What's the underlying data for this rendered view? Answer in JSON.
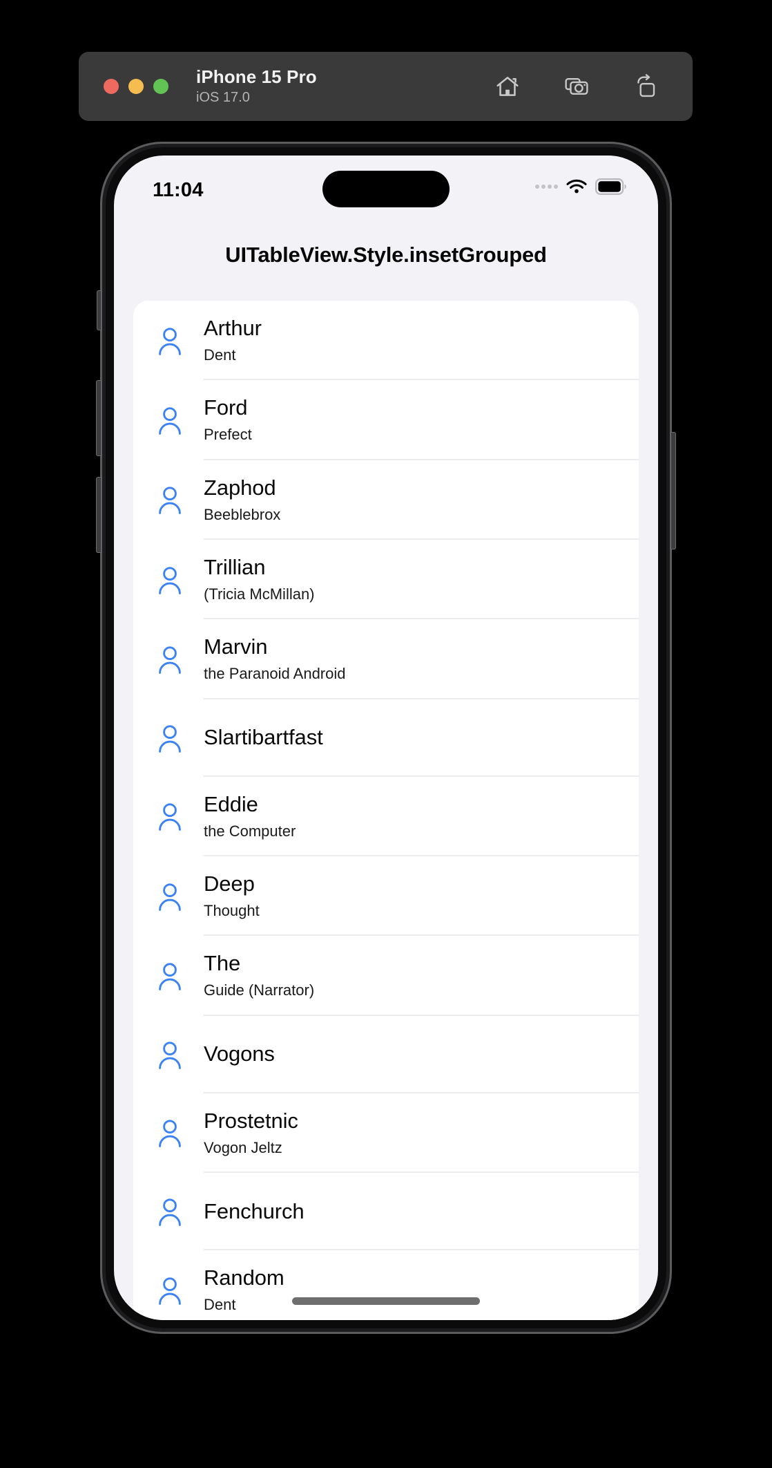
{
  "simulator": {
    "device_name": "iPhone 15 Pro",
    "os_version": "iOS 17.0",
    "window_controls": [
      {
        "name": "close",
        "color": "#ee6a5f"
      },
      {
        "name": "minimize",
        "color": "#f5bd4f"
      },
      {
        "name": "zoom",
        "color": "#61c454"
      }
    ],
    "toolbar": [
      {
        "icon": "home-icon",
        "label": "Home"
      },
      {
        "icon": "screenshot-camera-icon",
        "label": "Screenshot"
      },
      {
        "icon": "rotate-icon",
        "label": "Rotate"
      }
    ]
  },
  "status_bar": {
    "time": "11:04",
    "signal_icon": "signal-dots-icon",
    "wifi_icon": "wifi-icon",
    "battery_icon": "battery-icon"
  },
  "screen": {
    "page_title": "UITableView.Style.insetGrouped",
    "accent_color": "#3b82f6",
    "background_color": "#f2f2f7",
    "card_color": "#ffffff",
    "separator_color": "#ececee"
  },
  "table": {
    "style": "insetGrouped",
    "row_icon": "person-icon",
    "rows": [
      {
        "title": "Arthur",
        "subtitle": "Dent"
      },
      {
        "title": "Ford",
        "subtitle": "Prefect"
      },
      {
        "title": "Zaphod",
        "subtitle": "Beeblebrox"
      },
      {
        "title": "Trillian",
        "subtitle": "(Tricia McMillan)"
      },
      {
        "title": "Marvin",
        "subtitle": "the Paranoid Android"
      },
      {
        "title": "Slartibartfast",
        "subtitle": ""
      },
      {
        "title": "Eddie",
        "subtitle": "the Computer"
      },
      {
        "title": "Deep",
        "subtitle": "Thought"
      },
      {
        "title": "The",
        "subtitle": "Guide (Narrator)"
      },
      {
        "title": "Vogons",
        "subtitle": ""
      },
      {
        "title": "Prostetnic",
        "subtitle": "Vogon Jeltz"
      },
      {
        "title": "Fenchurch",
        "subtitle": ""
      },
      {
        "title": "Random",
        "subtitle": "Dent"
      }
    ]
  },
  "home_indicator": {
    "label": "Home indicator"
  }
}
